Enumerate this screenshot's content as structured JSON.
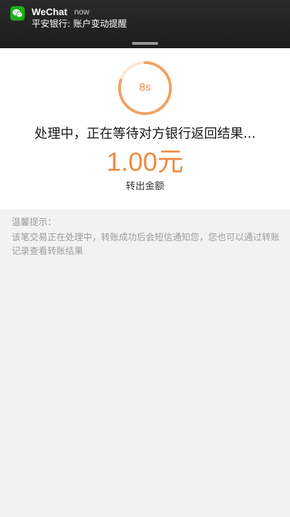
{
  "notification": {
    "app_name": "WeChat",
    "time": "now",
    "message": "平安银行: 账户变动提醒",
    "app_icon": "wechat-icon",
    "accent_color": "#1aad19"
  },
  "processing": {
    "countdown": "8s",
    "countdown_progress": 0.8,
    "status_text": "处理中，正在等待对方银行返回结果...",
    "amount": "1.00元",
    "amount_label": "转出金额",
    "accent_color": "#f08a40"
  },
  "tips": {
    "title": "温馨提示：",
    "body": "该笔交易正在处理中，转账成功后会短信通知您，您也可以通过转账记录查看转账结果"
  }
}
